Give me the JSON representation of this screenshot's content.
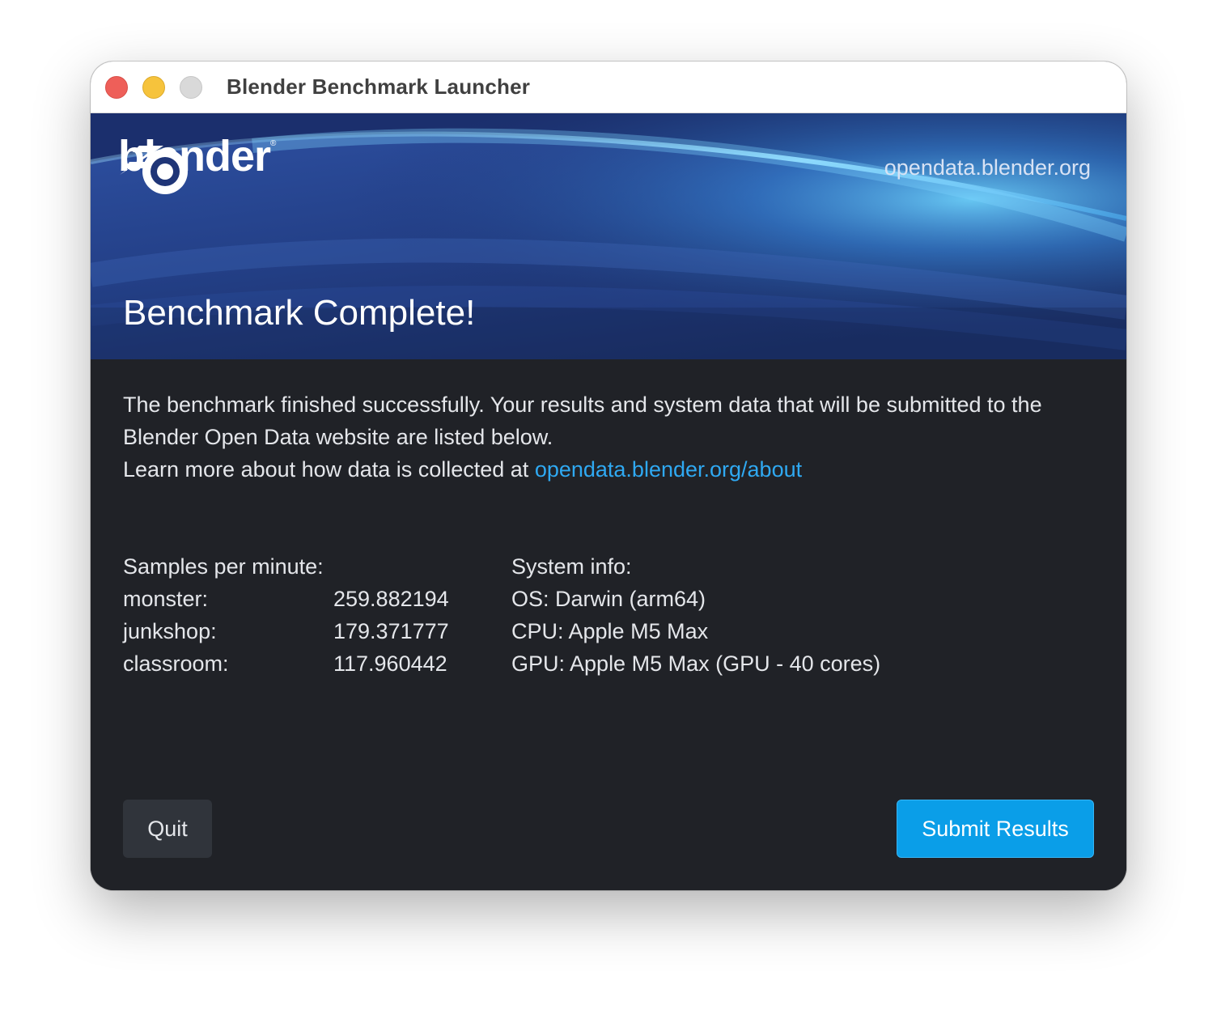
{
  "window": {
    "title": "Blender Benchmark Launcher"
  },
  "header": {
    "logo_text": "blender",
    "logo_mark": "®",
    "site_link": "opendata.blender.org",
    "heading": "Benchmark Complete!"
  },
  "intro": {
    "line1": "The benchmark finished successfully. Your results and system data that will be submitted to the",
    "line2": "Blender Open Data website are listed below.",
    "line3_prefix": "Learn more about how data is collected at ",
    "line3_link": "opendata.blender.org/about"
  },
  "results": {
    "heading": "Samples per minute:",
    "items": [
      {
        "name": "monster:",
        "value": "259.882194"
      },
      {
        "name": "junkshop:",
        "value": "179.371777"
      },
      {
        "name": "classroom:",
        "value": "117.960442"
      }
    ]
  },
  "system": {
    "heading": "System info:",
    "os": "OS: Darwin (arm64)",
    "cpu": "CPU: Apple M5 Max",
    "gpu": "GPU: Apple M5 Max (GPU - 40 cores)"
  },
  "buttons": {
    "quit": "Quit",
    "submit": "Submit Results"
  },
  "colors": {
    "content_background": "#202227",
    "link": "#2fa9f2",
    "submit_button": "#0a9ee8",
    "quit_button": "#30343b",
    "close_light": "#ee5f59",
    "minimize_light": "#f6c33c",
    "zoom_light": "#d9d9d9"
  },
  "icons": {
    "logo": "blender-logo-icon",
    "close": "close-window-icon",
    "minimize": "minimize-window-icon",
    "zoom": "zoom-window-icon"
  }
}
